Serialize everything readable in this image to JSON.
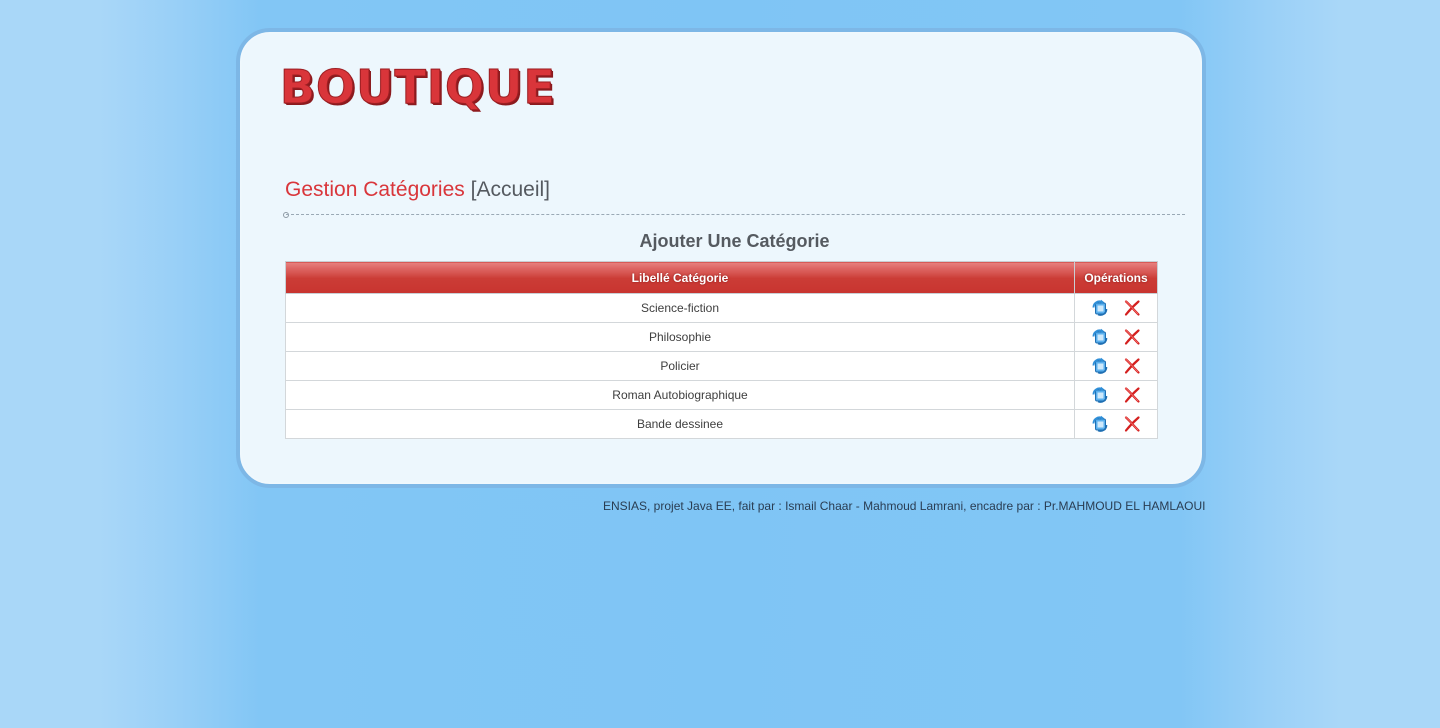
{
  "header": {
    "logo_text": "BOUTIQUE"
  },
  "page": {
    "title": "Gestion Catégories",
    "breadcrumb_open": "[",
    "breadcrumb_link": "Accueil",
    "breadcrumb_close": "]"
  },
  "actions": {
    "add_category_label": "Ajouter Une Catégorie"
  },
  "table": {
    "columns": [
      "Libellé Catégorie",
      "Opérations"
    ],
    "rows": [
      {
        "label": "Science-fiction"
      },
      {
        "label": "Philosophie"
      },
      {
        "label": "Policier"
      },
      {
        "label": "Roman Autobiographique"
      },
      {
        "label": "Bande dessinee"
      }
    ],
    "row_actions": {
      "edit_icon": "refresh-edit-icon",
      "delete_icon": "red-x-delete-icon"
    }
  },
  "footer": {
    "text": "ENSIAS, projet Java EE, fait par : Ismail Chaar - Mahmoud Lamrani, encadre par : Pr.MAHMOUD EL HAMLAOUI"
  },
  "colors": {
    "accent_red": "#d9363b",
    "panel_background": "#edf7fd",
    "panel_border": "#7db7e6",
    "page_background": "#7fc5f5",
    "edit_icon_blue": "#2f8fd8",
    "delete_icon_red": "#d4201f"
  }
}
